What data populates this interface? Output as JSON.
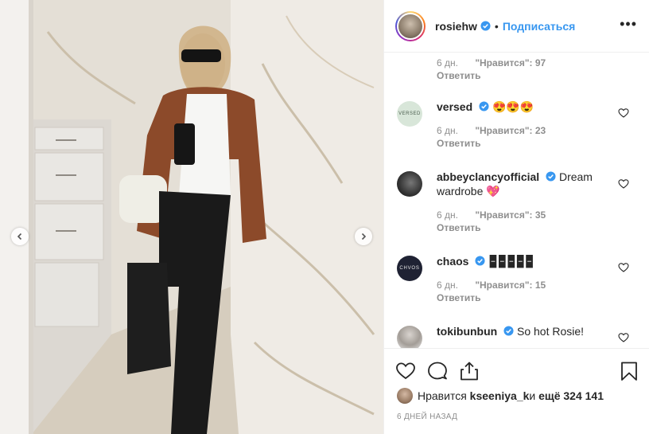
{
  "post": {
    "username": "rosiehw",
    "dot": "•",
    "follow_label": "Подписаться",
    "more_label": "•••"
  },
  "comments": [
    {
      "username": "",
      "text": "",
      "age": "6 дн.",
      "likes": "\"Нравится\": 97",
      "reply": "Ответить",
      "avatar": "none"
    },
    {
      "username": "versed",
      "text": "😍😍😍",
      "age": "6 дн.",
      "likes": "\"Нравится\": 23",
      "reply": "Ответить",
      "avatar": "versed-logo",
      "avatar_text": "VERSED"
    },
    {
      "username": "abbeyclancyofficial",
      "text": " Dream wardrobe 💖",
      "age": "6 дн.",
      "likes": "\"Нравится\": 35",
      "reply": "Ответить",
      "avatar": "profile-photo"
    },
    {
      "username": "chaos",
      "text": " 🁢🁢🁢🁢🁢",
      "age": "6 дн.",
      "likes": "\"Нравится\": 15",
      "reply": "Ответить",
      "avatar": "chaos-logo",
      "avatar_text": "CHVOS"
    },
    {
      "username": "tokibunbun",
      "text": " So hot Rosie!",
      "age": "",
      "likes": "",
      "reply": "",
      "avatar": "profile-photo"
    }
  ],
  "likes_line": {
    "prefix": "Нравится ",
    "user": "kseeniya_k",
    "middle": " и ",
    "count": "ещё 324 141"
  },
  "timestamp": "6 ДНЕЙ НАЗАД",
  "colors": {
    "link_blue": "#3897f0",
    "text": "#262626",
    "muted": "#8e8e8e",
    "divider": "#efefef"
  },
  "icons": [
    "verified-badge-icon",
    "heart-icon",
    "comment-icon",
    "share-icon",
    "bookmark-icon",
    "chevron-left-icon",
    "chevron-right-icon"
  ]
}
